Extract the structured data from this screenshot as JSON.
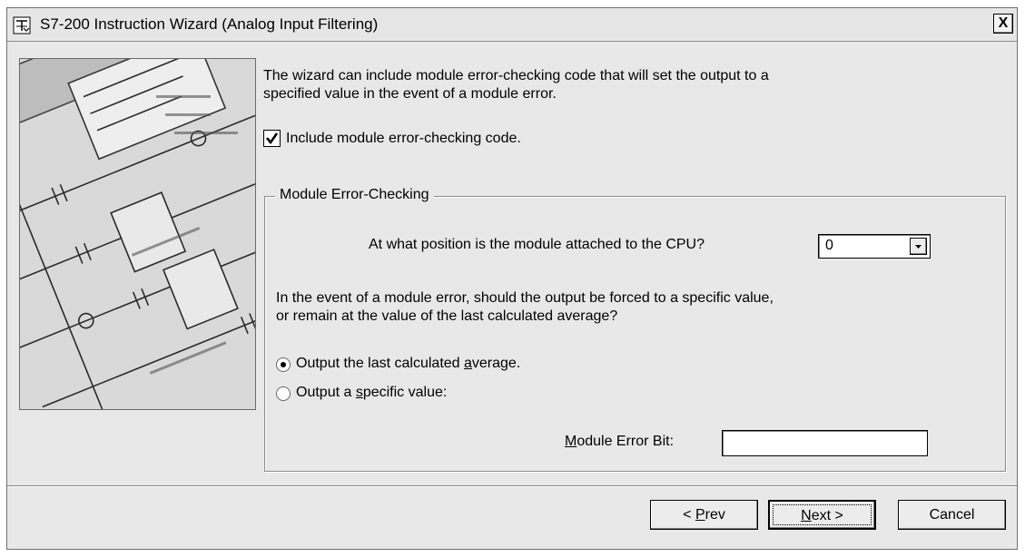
{
  "window": {
    "title": "S7-200 Instruction Wizard (Analog Input Filtering)",
    "close_label": "X",
    "icon": "wizard-window-icon"
  },
  "content": {
    "intro_line1": "The wizard can include module error-checking code that will set the output to a",
    "intro_line2": "specified value in the event of a module error.",
    "include_checkbox": {
      "label": "Include module error-checking code.",
      "checked": true
    }
  },
  "group": {
    "title": "Module Error-Checking",
    "position_question": "At what position is the module attached to the CPU?",
    "position_value": "0",
    "event_question_line1": "In the event of a module error, should the output be forced to a specific value,",
    "event_question_line2": "or remain at the value of the last calculated average?",
    "radio_average": {
      "prefix": "Output the last calculated ",
      "mnemonic": "a",
      "suffix": "verage.",
      "selected": true
    },
    "radio_specific": {
      "prefix": "Output a ",
      "mnemonic": "s",
      "suffix": "pecific value:",
      "selected": false
    },
    "error_bit": {
      "mnemonic": "M",
      "label_rest": "odule Error Bit:",
      "value": ""
    }
  },
  "buttons": {
    "prev": {
      "prefix": "< ",
      "mnemonic": "P",
      "suffix": "rev"
    },
    "next": {
      "mnemonic": "N",
      "suffix": "ext >"
    },
    "cancel": "Cancel"
  }
}
